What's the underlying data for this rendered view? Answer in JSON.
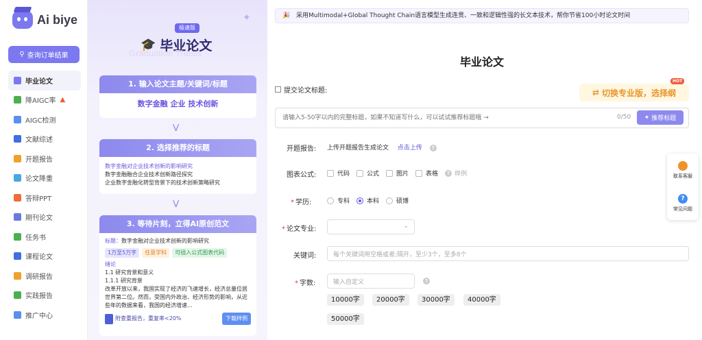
{
  "app": {
    "name": "Ai biye"
  },
  "sidebar": {
    "query_button": "查询订单结果",
    "items": [
      {
        "label": "毕业论文",
        "active": true,
        "icon": "mortarboard-icon",
        "color": "#7b78f0"
      },
      {
        "label": "降AIGC率",
        "icon": "aigc-down-icon",
        "color": "#4caf50",
        "hot": true
      },
      {
        "label": "AIGC检测",
        "icon": "aigc-check-icon",
        "color": "#5a8ef0"
      },
      {
        "label": "文献综述",
        "icon": "book-icon",
        "color": "#3f6fe0"
      },
      {
        "label": "开题报告",
        "icon": "report-icon",
        "color": "#f0a12c"
      },
      {
        "label": "论文降重",
        "icon": "chart-down-icon",
        "color": "#4aa8e0"
      },
      {
        "label": "答辩PPT",
        "icon": "ppt-icon",
        "color": "#f06c3a"
      },
      {
        "label": "期刊论文",
        "icon": "journal-icon",
        "color": "#6a7ae0"
      },
      {
        "label": "任务书",
        "icon": "task-icon",
        "color": "#4caf50"
      },
      {
        "label": "课程论文",
        "icon": "course-icon",
        "color": "#3f6fe0"
      },
      {
        "label": "调研报告",
        "icon": "survey-icon",
        "color": "#f0a12c"
      },
      {
        "label": "实践报告",
        "icon": "practice-icon",
        "color": "#4caf50"
      },
      {
        "label": "推广中心",
        "icon": "promo-icon",
        "color": "#5a8ef0"
      }
    ]
  },
  "left_panel": {
    "badge": "极速版",
    "title": "毕业论文",
    "ghost_text": "Graduation Thesis",
    "step1": {
      "title": "1. 输入论文主题/关键词/标题",
      "keywords": "数字金融 企业 技术创新"
    },
    "step2": {
      "title": "2. 选择推荐的标题",
      "titles": [
        "数字金融对企业技术创新的影响研究",
        "数字金融融合企业技术创新路径探究",
        "企业数字金融化转型背景下的技术创新策略研究"
      ]
    },
    "step3": {
      "title": "3. 等待片刻，立得AI原创范文",
      "label_prefix": "标题：",
      "paper_title": "数字金融对企业技术创新的影响研究",
      "tags": [
        "1万至5万字",
        "任意学科",
        "可插入公式图表代码"
      ],
      "section": "绪论",
      "sub1": "1.1 研究背景和意义",
      "sub2": "1.1.1 研究背景",
      "body": "改革开放以来，我国实现了经济的飞速增长，经济总量位居世界第二位。然而，受国内外政治、经济形势的影响，从近些年的数据来看，我国的经济增速...",
      "footer": "附查重报告，重复率<20%",
      "download": "下载样例"
    }
  },
  "banner": {
    "text": "采用Multimodal+Global Thought Chain语言模型生成连贯、一致和逻辑性强的长文本技术，帮你节省100小时论文时间"
  },
  "form": {
    "title": "毕业论文",
    "submit_label": "提交论文标题:",
    "switch_button": "切换专业版，选择纲",
    "hot_badge": "HOT",
    "title_placeholder": "请输入5-50字以内的完整标题，如果不知道写什么，可以试试推荐标题哦 →",
    "title_count": "0/50",
    "recommend_button": "推荐标题",
    "proposal_label": "开题报告:",
    "proposal_text": "上传开题报告生成论文",
    "proposal_link": "点击上传",
    "chart_label": "图表公式:",
    "chart_options": [
      "代码",
      "公式",
      "图片",
      "表格"
    ],
    "chart_sample": "样例",
    "degree_label": "学历:",
    "degrees": [
      "专科",
      "本科",
      "硕博"
    ],
    "degree_selected": "本科",
    "major_label": "论文专业:",
    "keyword_label": "关键词:",
    "keyword_placeholder": "每个关键词用空格或者;隔开，至少3个，至多8个",
    "wordcount_label": "字数:",
    "wordcount_placeholder": "输入自定义",
    "wordcount_options": [
      "10000字",
      "20000字",
      "30000字",
      "40000字",
      "50000字"
    ]
  },
  "floating": {
    "service": "联系客服",
    "faq": "常见问题"
  }
}
